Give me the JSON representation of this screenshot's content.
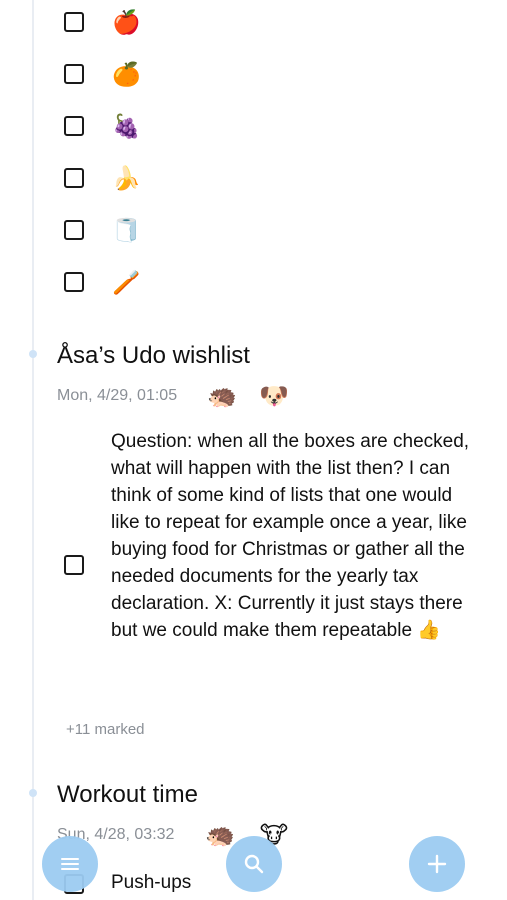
{
  "shopping_items": [
    {
      "emoji": "🍎",
      "icon": "apple-icon"
    },
    {
      "emoji": "🍊",
      "icon": "orange-icon"
    },
    {
      "emoji": "🍇",
      "icon": "grapes-icon"
    },
    {
      "emoji": "🍌",
      "icon": "banana-icon"
    },
    {
      "emoji": "🧻",
      "icon": "toilet-paper-icon"
    },
    {
      "emoji": "🪥",
      "icon": "toothbrush-icon"
    }
  ],
  "wishlist": {
    "title": "Åsa’s Udo wishlist",
    "date": "Mon, 4/29, 01:05",
    "avatars": [
      "🦔",
      "🐶"
    ],
    "item_text": "Question: when all the boxes are checked, what will happen with the list then? I can think of some kind of lists that one would like to repeat for example once a year, like buying food for Christmas or gather all the needed documents for the yearly tax declaration. X: Currently it just stays there but we could make them repeatable",
    "item_emoji": "👍",
    "marked": "+11 marked"
  },
  "workout": {
    "title": "Workout time",
    "date": "Sun, 4/28, 03:32",
    "avatars": [
      "🦔",
      "🐮"
    ],
    "first_item": "Push-ups"
  },
  "colors": {
    "fab": "#9cccf2",
    "timeline": "#e9edf3",
    "meta_text": "#8a8f96"
  }
}
